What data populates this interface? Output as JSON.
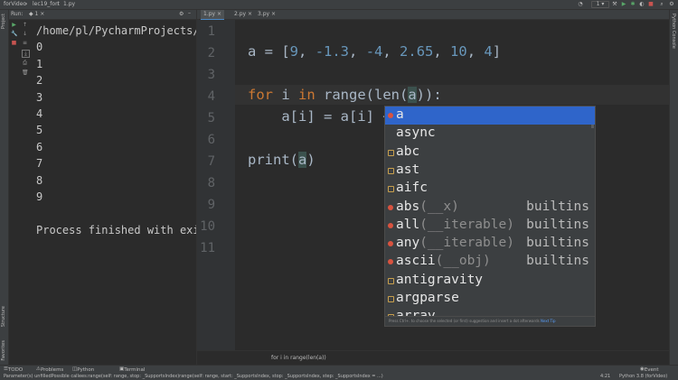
{
  "topbar": {
    "project": "forVideo",
    "folder": "lec19_fort",
    "file": "1.py",
    "run_config": "1"
  },
  "left_strip": {
    "project_label": "Project",
    "structure_label": "Structure",
    "favorites_label": "Favorites"
  },
  "right_strip": {
    "label": "Python Console"
  },
  "run_panel": {
    "tab_label": "Run:",
    "config_label": "1",
    "console_lines": [
      "/home/pl/PycharmProjects/fo",
      "0",
      "1",
      "2",
      "3",
      "4",
      "5",
      "6",
      "7",
      "8",
      "9",
      "",
      "Process finished with exit"
    ]
  },
  "editor": {
    "tabs": [
      "1.py",
      "2.py",
      "3.py"
    ],
    "line_numbers": [
      "1",
      "2",
      "3",
      "4",
      "5",
      "6",
      "7",
      "8",
      "9",
      "10",
      "11"
    ],
    "code": {
      "line2": {
        "name": "a",
        "op": " = [",
        "n1": "9",
        "c1": ", ",
        "n2": "-1.3",
        "c2": ", ",
        "n3": "-4",
        "c3": ", ",
        "n4": "2.65",
        "c4": ", ",
        "n5": "10",
        "c5": ", ",
        "n6": "4",
        "end": "]"
      },
      "line4": {
        "kw_for": "for",
        "var": " i ",
        "kw_in": "in",
        "call": " range(len(",
        "arg": "a",
        "end": ")):"
      },
      "line5": {
        "text": "    a[i] = a[i] +"
      },
      "line7": {
        "fn": "print(",
        "arg": "a",
        "end": ")"
      }
    },
    "breadcrumb": "for i in range(len(a))"
  },
  "completion": {
    "items": [
      {
        "name": "a",
        "sig": "",
        "source": "",
        "icon": "variable-icon",
        "selected": true
      },
      {
        "name": "async",
        "sig": "",
        "source": "",
        "icon": "keyword-icon"
      },
      {
        "name": "abc",
        "sig": "",
        "source": "",
        "icon": "module-icon"
      },
      {
        "name": "ast",
        "sig": "",
        "source": "",
        "icon": "module-icon"
      },
      {
        "name": "aifc",
        "sig": "",
        "source": "",
        "icon": "module-icon"
      },
      {
        "name": "abs",
        "sig": "(__x)",
        "source": "builtins",
        "icon": "function-icon"
      },
      {
        "name": "all",
        "sig": "(__iterable)",
        "source": "builtins",
        "icon": "function-icon"
      },
      {
        "name": "any",
        "sig": "(__iterable)",
        "source": "builtins",
        "icon": "function-icon"
      },
      {
        "name": "ascii",
        "sig": "(__obj)",
        "source": "builtins",
        "icon": "function-icon"
      },
      {
        "name": "antigravity",
        "sig": "",
        "source": "",
        "icon": "module-icon"
      },
      {
        "name": "argparse",
        "sig": "",
        "source": "",
        "icon": "module-icon"
      },
      {
        "name": "array",
        "sig": "",
        "source": "",
        "icon": "module-icon"
      }
    ],
    "footer_text": "Press Ctrl+. to choose the selected (or first) suggestion and insert a dot afterwards",
    "footer_link": "Next Tip"
  },
  "bottom_tools": [
    "TODO",
    "Problems",
    "Python Packages",
    "Terminal"
  ],
  "event_log": "Event Log",
  "status": {
    "message": "Parameter(s) unfilledPossible callees:range(self: range, stop: _SupportsIndex)range(self: range, start: _SupportsIndex, stop: _SupportsIndex, step: _SupportsIndex = ...)",
    "position": "4:21",
    "interpreter": "Python 3.8 (forVideo)"
  },
  "colors": {
    "keyword": "#cc7832",
    "number": "#6897bb",
    "selection": "#2f65ca",
    "background": "#2b2b2b"
  }
}
